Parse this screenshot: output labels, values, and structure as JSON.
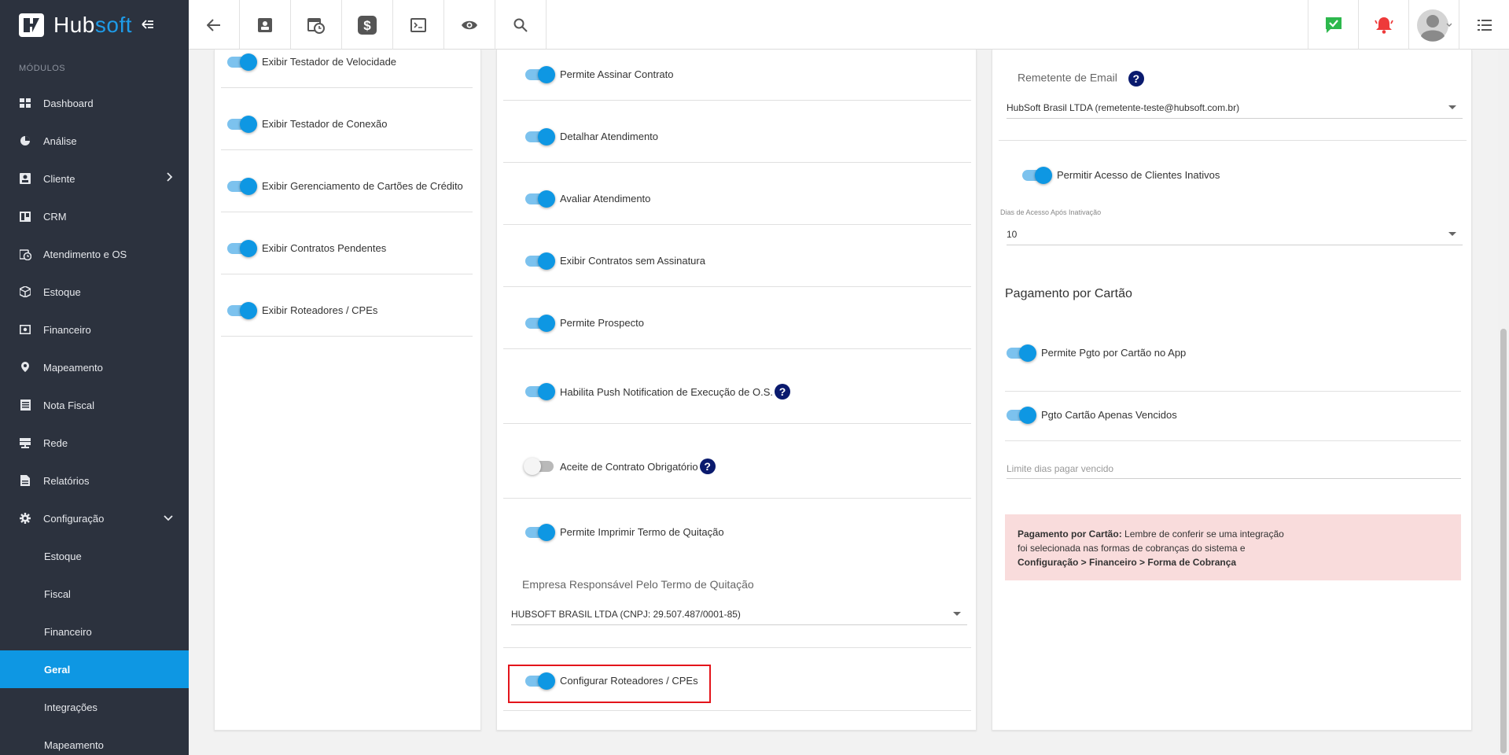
{
  "brand": {
    "name_main": "Hub",
    "name_accent": "soft"
  },
  "sidebar": {
    "section_title": "MÓDULOS",
    "items": [
      {
        "label": "Dashboard",
        "icon": "dashboard-icon"
      },
      {
        "label": "Análise",
        "icon": "pie-chart-icon"
      },
      {
        "label": "Cliente",
        "icon": "contact-card-icon"
      },
      {
        "label": "CRM",
        "icon": "board-icon"
      },
      {
        "label": "Atendimento e OS",
        "icon": "calendar-clock-icon"
      },
      {
        "label": "Estoque",
        "icon": "box-icon"
      },
      {
        "label": "Financeiro",
        "icon": "money-icon"
      },
      {
        "label": "Mapeamento",
        "icon": "map-pin-icon"
      },
      {
        "label": "Nota Fiscal",
        "icon": "receipt-icon"
      },
      {
        "label": "Rede",
        "icon": "server-icon"
      },
      {
        "label": "Relatórios",
        "icon": "report-icon"
      },
      {
        "label": "Configuração",
        "icon": "gear-icon"
      }
    ],
    "sub_items": [
      {
        "label": "Estoque"
      },
      {
        "label": "Fiscal"
      },
      {
        "label": "Financeiro"
      },
      {
        "label": "Geral"
      },
      {
        "label": "Integrações"
      },
      {
        "label": "Mapeamento"
      }
    ]
  },
  "panel1": {
    "toggles": [
      {
        "label": "Exibir Testador de Velocidade",
        "on": true
      },
      {
        "label": "Exibir Testador de Conexão",
        "on": true
      },
      {
        "label": "Exibir Gerenciamento de Cartões de Crédito",
        "on": true
      },
      {
        "label": "Exibir Contratos Pendentes",
        "on": true
      },
      {
        "label": "Exibir Roteadores / CPEs",
        "on": true
      }
    ]
  },
  "panel2": {
    "toggles": [
      {
        "label": "Permite Assinar Contrato",
        "on": true
      },
      {
        "label": "Detalhar Atendimento",
        "on": true
      },
      {
        "label": "Avaliar Atendimento",
        "on": true
      },
      {
        "label": "Exibir Contratos sem Assinatura",
        "on": true
      },
      {
        "label": "Permite Prospecto",
        "on": true
      },
      {
        "label": "Habilita Push Notification de Execução de O.S.",
        "on": true
      },
      {
        "label": "Aceite de Contrato Obrigatório",
        "on": false
      },
      {
        "label": "Permite Imprimir Termo de Quitação",
        "on": true
      }
    ],
    "help_glyph": "?",
    "empresa_label": "Empresa Responsável Pelo Termo de Quitação",
    "empresa_value": "HUBSOFT BRASIL LTDA (CNPJ: 29.507.487/0001-85)",
    "roteadores_label": "Configurar Roteadores / CPEs"
  },
  "panel3": {
    "remetente_label": "Remetente de Email",
    "remetente_value": "HubSoft Brasil LTDA (remetente-teste@hubsoft.com.br)",
    "inativos_label": "Permitir Acesso de Clientes Inativos",
    "dias_label": "Dias de Acesso Após Inativação",
    "dias_value": "10",
    "cartao_heading": "Pagamento por Cartão",
    "pgto_app_label": "Permite Pgto por Cartão no App",
    "pgto_vencidos_label": "Pgto Cartão Apenas Vencidos",
    "limite_placeholder": "Limite dias pagar vencido",
    "alert_bold": "Pagamento por Cartão:",
    "alert_text1": " Lembre de conferir se uma integração",
    "alert_text2": "foi selecionada nas formas de cobranças do sistema e",
    "alert_path": "Configuração > Financeiro > Forma de Cobrança"
  },
  "colors": {
    "accent": "#0e97e3",
    "sidebar_bg": "#2c323e",
    "alert_bg": "#f9dcdc",
    "highlight": "#e3141b"
  }
}
